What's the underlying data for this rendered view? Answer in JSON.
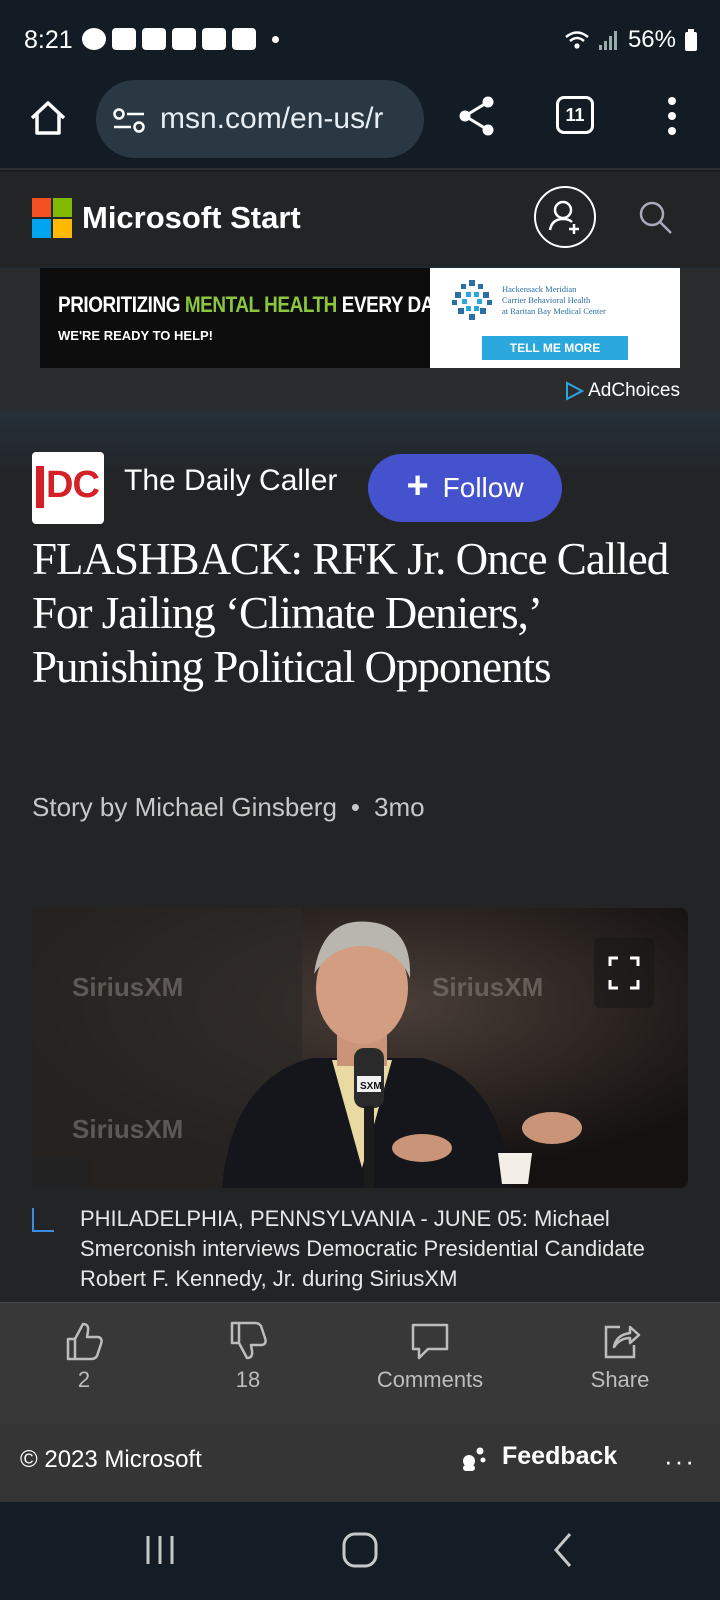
{
  "status_bar": {
    "time": "8:21",
    "battery": "56%"
  },
  "browser": {
    "url": "msn.com/en-us/r",
    "tab_count": "11"
  },
  "header": {
    "title": "Microsoft Start"
  },
  "ad": {
    "headline_part1": "PRIORITIZING ",
    "headline_highlight": "MENTAL HEALTH",
    "headline_part2": " EVERY DAY.",
    "subline": "WE'RE READY TO HELP!",
    "org_line1": "Hackensack Meridian",
    "org_line2": "Carrier Behavioral Health",
    "org_line3": "at Raritan Bay Medical Center",
    "cta": "TELL ME MORE",
    "adchoices": "AdChoices"
  },
  "article": {
    "publisher_logo": "DC",
    "publisher": "The Daily Caller",
    "follow_label": "Follow",
    "headline": "FLASHBACK: RFK Jr. Once Called For Jailing ‘Climate Deniers,’ Punishing Political Opponents",
    "byline": "Story by Michael Ginsberg",
    "age": "3mo",
    "caption": "PHILADELPHIA, PENNSYLVANIA - JUNE 05: Michael Smerconish interviews Democratic Presidential Candidate Robert F. Kennedy, Jr. during SiriusXM"
  },
  "photo": {
    "brand_watermark": "SiriusXM",
    "mic_label": "SXM"
  },
  "actions": {
    "like_count": "2",
    "dislike_count": "18",
    "comments_label": "Comments",
    "share_label": "Share"
  },
  "footer": {
    "copyright": "© 2023 Microsoft",
    "feedback_label": "Feedback",
    "more_label": "···"
  },
  "colors": {
    "follow_button": "#4552cd",
    "ad_green": "#8cc63f",
    "ad_cta": "#2aa7dd",
    "caption_accent": "#3a8de0",
    "dc_red": "#d42027"
  }
}
